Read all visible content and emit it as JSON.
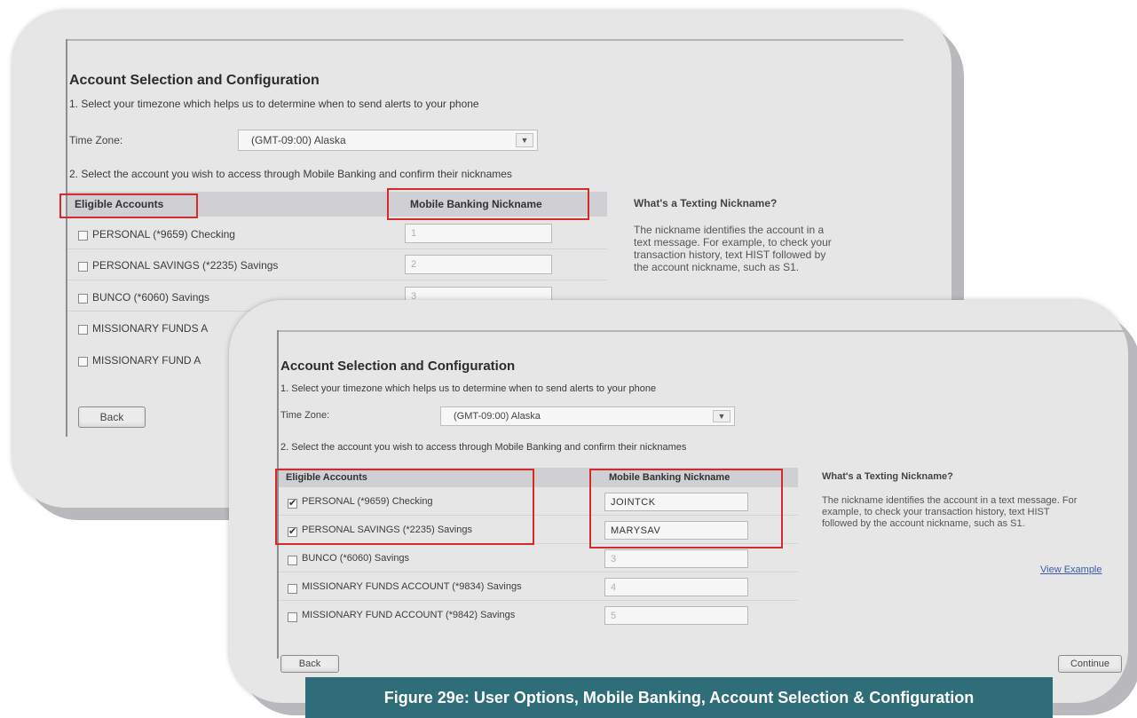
{
  "page": {
    "title": "Account Selection and Configuration",
    "step1": "1. Select your timezone which helps us to determine when to send alerts to your phone",
    "timezone_label": "Time Zone:",
    "timezone_value": "(GMT-09:00) Alaska",
    "step2": "2. Select the account you wish to access through Mobile Banking and confirm their nicknames",
    "col_accounts": "Eligible Accounts",
    "col_nickname": "Mobile Banking Nickname",
    "help_title": "What's a Texting Nickname?",
    "help_text": "The nickname identifies the account in a text message. For example, to check your transaction history, text HIST followed by the account nickname, such as S1.",
    "view_example": "View Example",
    "back": "Back",
    "continue": "Continue"
  },
  "back_screen": {
    "accounts": [
      {
        "name": "PERSONAL (*9659) Checking",
        "checked": false,
        "nickname": "1"
      },
      {
        "name": "PERSONAL SAVINGS (*2235) Savings",
        "checked": false,
        "nickname": "2"
      },
      {
        "name": "BUNCO (*6060) Savings",
        "checked": false,
        "nickname": "3"
      },
      {
        "name": "MISSIONARY FUNDS A",
        "checked": false
      },
      {
        "name": "MISSIONARY FUND A",
        "checked": false
      }
    ]
  },
  "front_screen": {
    "accounts": [
      {
        "name": "PERSONAL (*9659) Checking",
        "checked": true,
        "nickname": "JOINTCK"
      },
      {
        "name": "PERSONAL SAVINGS (*2235) Savings",
        "checked": true,
        "nickname": "MARYSAV"
      },
      {
        "name": "BUNCO (*6060) Savings",
        "checked": false,
        "nickname": "3"
      },
      {
        "name": "MISSIONARY FUNDS ACCOUNT (*9834) Savings",
        "checked": false,
        "nickname": "4"
      },
      {
        "name": "MISSIONARY FUND ACCOUNT (*9842) Savings",
        "checked": false,
        "nickname": "5"
      }
    ]
  },
  "caption": "Figure 29e: User Options, Mobile Banking, Account Selection & Configuration",
  "colors": {
    "highlight": "#d42a2a",
    "caption_bg": "#2f6e79",
    "header_bg": "#cfcfd4",
    "card_bg": "#e6e6e6"
  }
}
